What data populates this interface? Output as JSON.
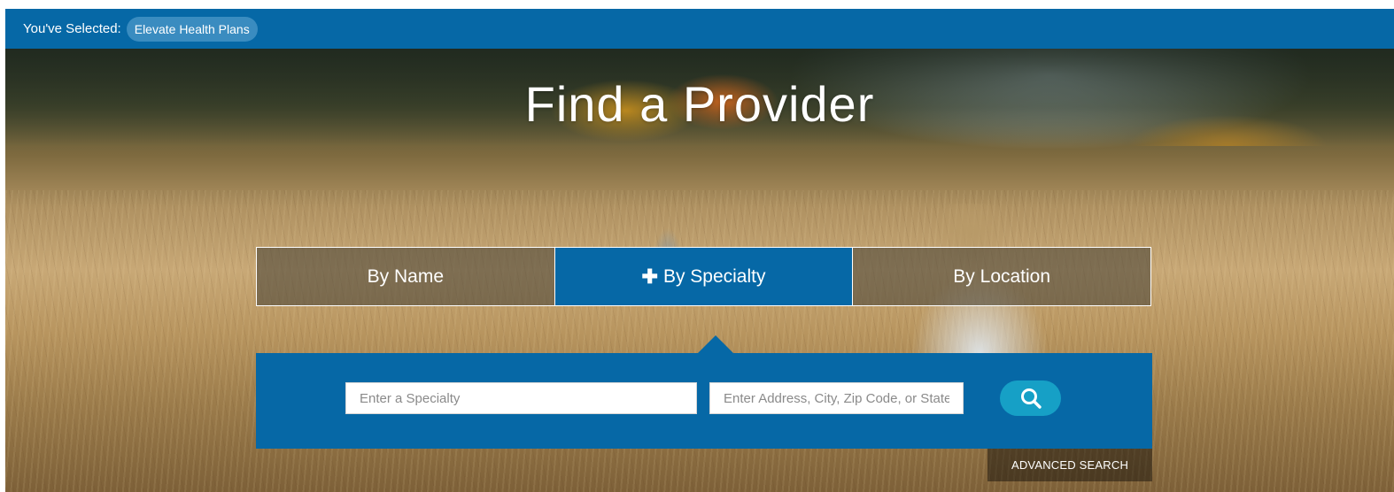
{
  "selection_bar": {
    "label": "You've Selected:",
    "selected_plan": "Elevate Health Plans"
  },
  "hero": {
    "title": "Find a Provider"
  },
  "tabs": [
    {
      "label": "By Name",
      "active": false
    },
    {
      "label": "By Specialty",
      "active": true,
      "icon": "plus-icon"
    },
    {
      "label": "By Location",
      "active": false
    }
  ],
  "search": {
    "specialty_placeholder": "Enter a Specialty",
    "address_placeholder": "Enter Address, City, Zip Code, or State",
    "search_icon": "search-icon",
    "advanced_label": "ADVANCED SEARCH"
  },
  "colors": {
    "primary_blue": "#0668a6",
    "chip_blue": "#3a8cc0",
    "search_button": "#16a0c6"
  }
}
